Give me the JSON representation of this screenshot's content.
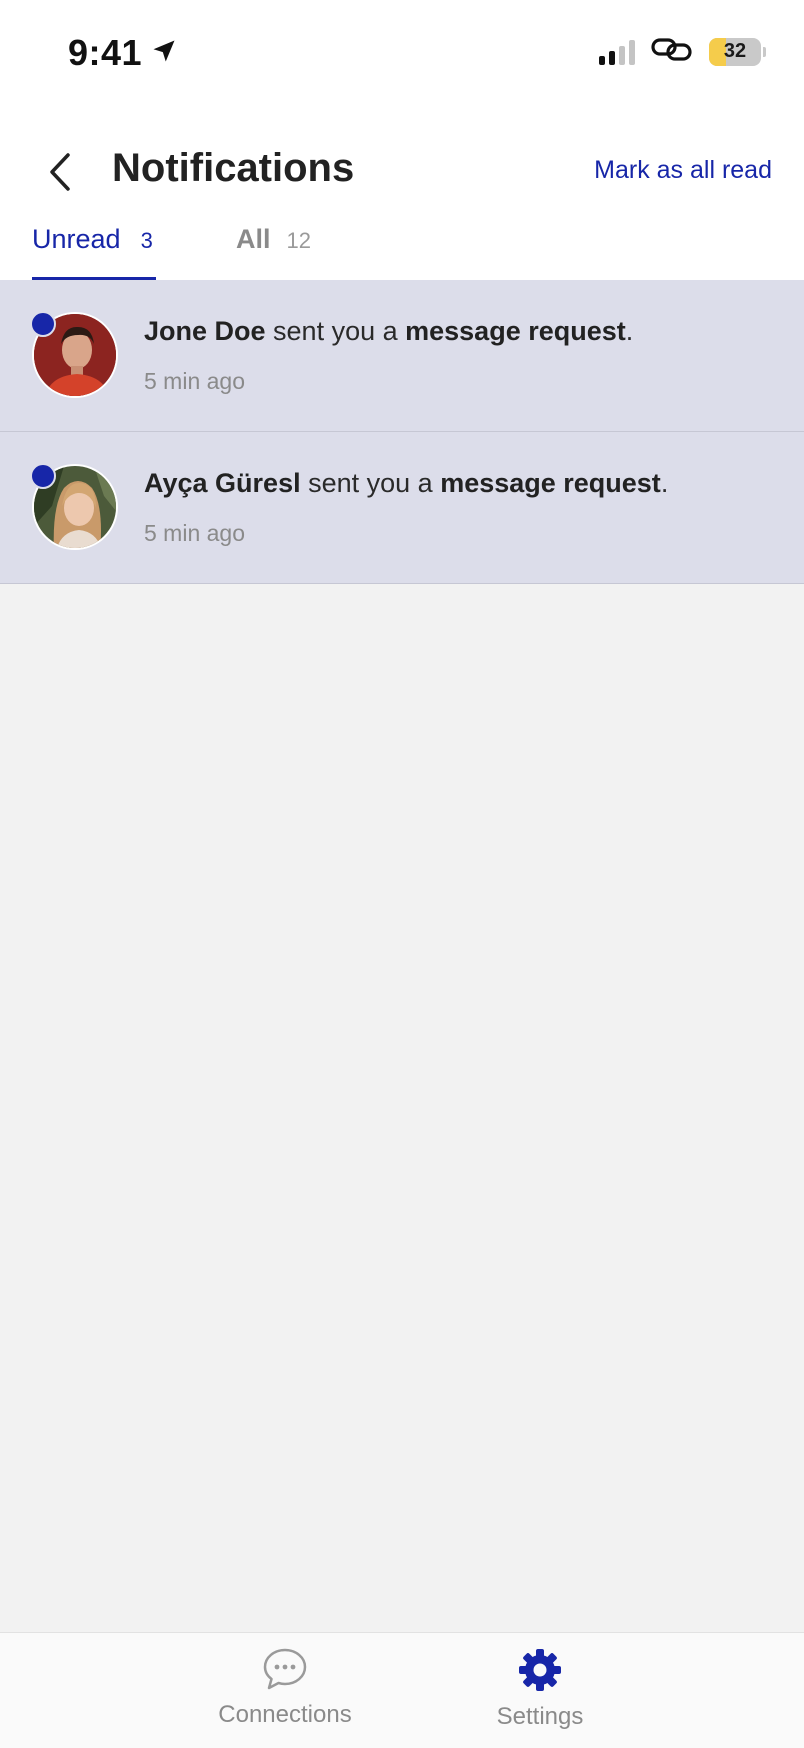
{
  "status_bar": {
    "time": "9:41",
    "battery_level": "32",
    "battery_fill_fraction": 0.32,
    "icons": [
      "location-arrow-icon",
      "signal-icon",
      "link-icon",
      "battery-icon"
    ]
  },
  "header": {
    "title": "Notifications",
    "mark_all_read_label": "Mark as all read",
    "back_icon": "chevron-left-icon"
  },
  "tabs": [
    {
      "label": "Unread",
      "count": "3",
      "active": true
    },
    {
      "label": "All",
      "count": "12",
      "active": false
    }
  ],
  "notifications": [
    {
      "name": "Jone Doe",
      "text_middle": " sent you a ",
      "text_bold": "message request",
      "text_end": ".",
      "time": "5 min ago",
      "unread": true
    },
    {
      "name": "Ayça Güresl",
      "text_middle": " sent you a ",
      "text_bold": "message request",
      "text_end": ".",
      "time": "5 min ago",
      "unread": true
    }
  ],
  "bottom_nav": [
    {
      "label": "Connections",
      "icon": "chat-bubble-icon",
      "active": false
    },
    {
      "label": "Settings",
      "icon": "gear-icon",
      "active": true
    }
  ],
  "colors": {
    "accent": "#1726a8",
    "unread_row_bg": "#dcddea",
    "page_bg": "#f2f2f2",
    "battery_fill": "#f5cc4b"
  }
}
